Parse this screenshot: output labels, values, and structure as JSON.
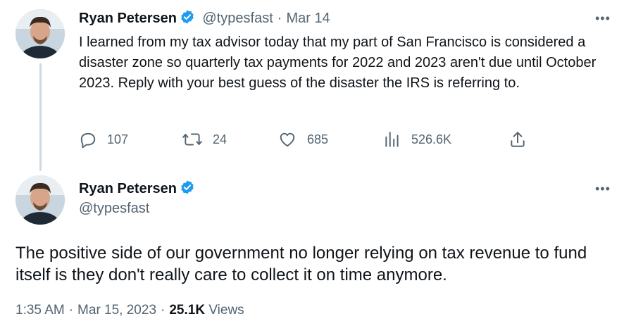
{
  "tweet1": {
    "author_name": "Ryan Petersen",
    "author_handle": "@typesfast",
    "date": "Mar 14",
    "separator": "·",
    "more": "•••",
    "text": "I learned from my tax advisor today that my part of San Francisco is considered a disaster zone so quarterly tax payments for 2022 and 2023 aren't due until October 2023. Reply with your best guess of the disaster the IRS is referring to.",
    "replies": "107",
    "retweets": "24",
    "likes": "685",
    "views": "526.6K"
  },
  "tweet2": {
    "author_name": "Ryan Petersen",
    "author_handle": "@typesfast",
    "more": "•••",
    "text": "The positive side of our government no longer relying on tax revenue to fund itself is they don't really care to collect it on time anymore.",
    "time": "1:35 AM",
    "date": "Mar 15, 2023",
    "views_count": "25.1K",
    "views_label": "Views",
    "separator": "·"
  },
  "colors": {
    "text": "#0f1419",
    "secondary": "#536471",
    "verified": "#1d9bf0",
    "thread_line": "#cfd9de"
  },
  "icons": [
    "reply-icon",
    "retweet-icon",
    "like-icon",
    "views-icon",
    "share-icon",
    "verified-badge-icon",
    "more-icon"
  ]
}
